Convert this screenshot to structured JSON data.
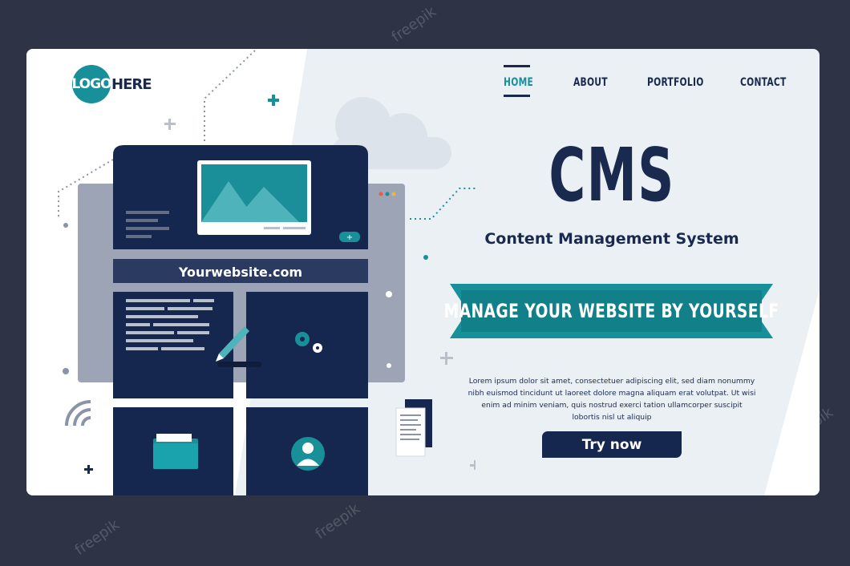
{
  "logo": {
    "circle_text": "LOGO",
    "rest_text": "HERE"
  },
  "nav": {
    "items": [
      {
        "label": "HOME",
        "active": true
      },
      {
        "label": "ABOUT",
        "active": false
      },
      {
        "label": "PORTFOLIO",
        "active": false
      },
      {
        "label": "CONTACT",
        "active": false
      }
    ]
  },
  "hero": {
    "title": "CMS",
    "subtitle": "Content Management System",
    "banner": "MANAGE YOUR WEBSITE BY YOURSELF",
    "body": "Lorem ipsum dolor sit amet, consectetuer adipiscing elit, sed diam nonummy nibh euismod tincidunt ut laoreet dolore magna aliquam erat volutpat. Ut wisi enim ad minim veniam, quis nostrud exerci tation ullamcorper suscipit lobortis nisl ut aliquip",
    "cta": "Try now"
  },
  "illustration": {
    "url": "Yourwebsite.com",
    "small_button": "+"
  },
  "watermark": "freepik",
  "colors": {
    "navy": "#16274f",
    "teal": "#17909a",
    "background": "#2e3445",
    "card": "#ebf0f5"
  }
}
